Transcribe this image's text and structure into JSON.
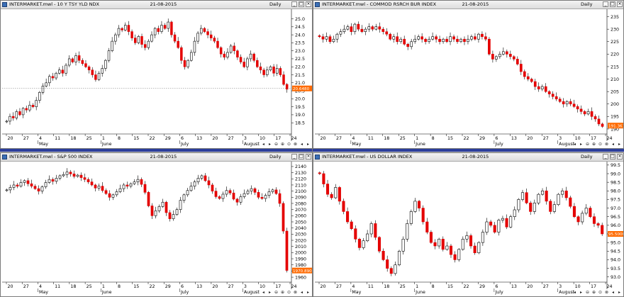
{
  "panes": [
    {
      "id": "tyx",
      "title": "INTERMARKET.mwl - 10 Y TSY YLD NDX",
      "date": "21-08-2015",
      "period": "Daily",
      "price_label": "20.6480",
      "last_value": 20.648,
      "chart_data": {
        "type": "candlestick",
        "ylim": [
          17.8,
          25.6
        ],
        "yticks": [
          "18.5",
          "19.0",
          "19.5",
          "20.0",
          "20.5",
          "21.0",
          "21.5",
          "22.0",
          "22.5",
          "23.0",
          "23.5",
          "24.0",
          "24.5",
          "25.0"
        ],
        "xticks": [
          "20",
          "27",
          "4",
          "11",
          "18",
          "25",
          "1",
          "8",
          "15",
          "22",
          "29",
          "6",
          "13",
          "20",
          "27",
          "3",
          "10",
          "17",
          "24"
        ],
        "months": [
          "May",
          "June",
          "July",
          "August"
        ],
        "values": [
          18.6,
          18.9,
          18.8,
          19.2,
          19.0,
          19.4,
          19.3,
          19.6,
          19.5,
          19.9,
          20.4,
          20.8,
          21.0,
          21.4,
          21.3,
          21.6,
          21.8,
          21.6,
          22.1,
          22.5,
          22.3,
          22.7,
          22.4,
          22.2,
          22.0,
          21.8,
          21.5,
          21.2,
          21.6,
          21.9,
          22.4,
          23.0,
          23.6,
          24.0,
          24.4,
          24.3,
          24.6,
          24.2,
          23.8,
          23.5,
          23.9,
          23.4,
          23.2,
          23.6,
          24.0,
          24.4,
          24.2,
          24.6,
          24.4,
          24.8,
          24.0,
          23.6,
          23.2,
          22.4,
          22.0,
          22.4,
          22.9,
          23.6,
          24.1,
          24.4,
          24.2,
          24.0,
          23.8,
          23.6,
          23.2,
          22.8,
          22.6,
          22.9,
          23.3,
          23.0,
          22.6,
          22.3,
          22.0,
          22.5,
          22.8,
          22.4,
          22.0,
          21.8,
          21.5,
          21.8,
          22.0,
          21.6,
          21.9,
          21.5,
          20.9,
          20.6
        ]
      }
    },
    {
      "id": "crb",
      "title": "INTERMARKET.mwl - COMMOD RSRCH BUR INDEX",
      "date": "21-08-2015",
      "period": "Daily",
      "price_label": "191.3610",
      "last_value": 191.361,
      "chart_data": {
        "type": "candlestick",
        "ylim": [
          188,
          238
        ],
        "yticks": [
          "190",
          "195",
          "200",
          "205",
          "210",
          "215",
          "220",
          "225",
          "230",
          "235"
        ],
        "xticks": [
          "20",
          "27",
          "4",
          "11",
          "18",
          "25",
          "1",
          "8",
          "15",
          "22",
          "29",
          "6",
          "13",
          "20",
          "27",
          "3",
          "10",
          "17",
          "24"
        ],
        "months": [
          "May",
          "June",
          "July",
          "August"
        ],
        "values": [
          227,
          226,
          227,
          225,
          226,
          228,
          229,
          230,
          231,
          229,
          232,
          230,
          229,
          230,
          231,
          230,
          231,
          230,
          229,
          228,
          226,
          227,
          225,
          226,
          224,
          223,
          225,
          226,
          227,
          226,
          225,
          226,
          227,
          226,
          225,
          226,
          225,
          227,
          226,
          225,
          226,
          225,
          226,
          227,
          226,
          228,
          227,
          226,
          220,
          218,
          219,
          220,
          221,
          220,
          219,
          218,
          216,
          213,
          211,
          210,
          209,
          207,
          206,
          207,
          205,
          204,
          203,
          202,
          201,
          200,
          201,
          200,
          199,
          198,
          197,
          196,
          197,
          195,
          194,
          192,
          191
        ]
      }
    },
    {
      "id": "spx",
      "title": "INTERMARKET.mwl - S&P 500 INDEX",
      "date": "21-08-2015",
      "period": "Daily",
      "price_label": "1970.890",
      "last_value": 1970.89,
      "chart_data": {
        "type": "candlestick",
        "ylim": [
          1952,
          2148
        ],
        "yticks": [
          "1960",
          "1970",
          "1980",
          "1990",
          "2000",
          "2010",
          "2020",
          "2030",
          "2040",
          "2050",
          "2060",
          "2070",
          "2080",
          "2090",
          "2100",
          "2110",
          "2120",
          "2130",
          "2140"
        ],
        "xticks": [
          "20",
          "27",
          "4",
          "11",
          "18",
          "25",
          "1",
          "8",
          "15",
          "22",
          "29",
          "6",
          "13",
          "20",
          "27",
          "3",
          "10",
          "17",
          "24"
        ],
        "months": [
          "May",
          "June",
          "July",
          "August"
        ],
        "values": [
          2102,
          2106,
          2110,
          2108,
          2114,
          2117,
          2112,
          2108,
          2104,
          2100,
          2107,
          2114,
          2119,
          2116,
          2121,
          2125,
          2127,
          2131,
          2128,
          2124,
          2126,
          2122,
          2119,
          2115,
          2110,
          2105,
          2108,
          2101,
          2096,
          2090,
          2094,
          2099,
          2104,
          2110,
          2108,
          2112,
          2115,
          2119,
          2111,
          2098,
          2076,
          2060,
          2068,
          2075,
          2082,
          2065,
          2055,
          2062,
          2070,
          2085,
          2094,
          2101,
          2108,
          2115,
          2121,
          2125,
          2117,
          2110,
          2100,
          2091,
          2088,
          2095,
          2101,
          2097,
          2087,
          2082,
          2091,
          2096,
          2100,
          2104,
          2098,
          2090,
          2088,
          2093,
          2099,
          2102,
          2096,
          2080,
          2035,
          1971
        ]
      }
    },
    {
      "id": "dxy",
      "title": "INTERMARKET.mwl - US DOLLAR INDEX",
      "date": "21-08-2015",
      "period": "Daily",
      "price_label": "95.5000",
      "last_value": 95.5,
      "chart_data": {
        "type": "candlestick",
        "ylim": [
          92.7,
          99.7
        ],
        "yticks": [
          "93.0",
          "93.5",
          "94.0",
          "94.5",
          "95.0",
          "95.5",
          "96.0",
          "96.5",
          "97.0",
          "97.5",
          "98.0",
          "98.5",
          "99.0",
          "99.5"
        ],
        "xticks": [
          "20",
          "27",
          "4",
          "11",
          "18",
          "25",
          "1",
          "8",
          "15",
          "22",
          "29",
          "6",
          "13",
          "20",
          "27",
          "3",
          "10",
          "17",
          "24"
        ],
        "months": [
          "May",
          "June",
          "July",
          "August"
        ],
        "values": [
          99.0,
          98.4,
          97.8,
          97.6,
          98.2,
          97.4,
          96.8,
          96.2,
          95.8,
          95.2,
          94.7,
          95.1,
          95.5,
          96.1,
          95.3,
          94.5,
          94.0,
          93.5,
          93.2,
          93.7,
          94.5,
          95.2,
          96.1,
          96.8,
          97.4,
          97.0,
          96.2,
          95.6,
          95.0,
          94.8,
          95.2,
          94.6,
          94.8,
          94.3,
          94.0,
          94.6,
          95.2,
          95.4,
          94.8,
          94.4,
          95.0,
          95.6,
          96.2,
          96.0,
          95.6,
          96.3,
          96.4,
          95.9,
          96.5,
          96.9,
          97.5,
          97.9,
          97.3,
          96.8,
          97.3,
          97.8,
          98.0,
          97.4,
          96.8,
          97.2,
          97.8,
          98.0,
          97.6,
          97.1,
          96.5,
          96.2,
          96.7,
          97.0,
          96.5,
          96.1,
          96.0,
          95.5
        ]
      }
    }
  ]
}
